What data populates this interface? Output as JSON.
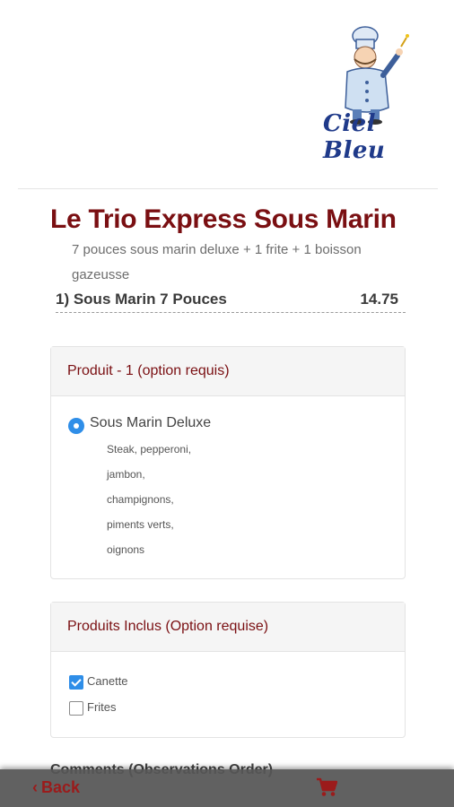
{
  "header": {
    "logo_text": "Ciel Bleu"
  },
  "product": {
    "title": "Le Trio Express Sous Marin",
    "description": "7 pouces sous marin deluxe + 1 frite + 1 boisson gazeusse",
    "item_name": "1) Sous Marin 7 Pouces",
    "item_price": "14.75"
  },
  "options_panel": {
    "heading": "Produit - 1 (option requis)",
    "selected_option": "Sous Marin Deluxe",
    "ingredients": [
      "Steak, pepperoni,",
      "jambon,",
      "champignons,",
      "piments verts,",
      "oignons"
    ]
  },
  "included_panel": {
    "heading": "Produits Inclus (Option requise)",
    "items": [
      {
        "label": "Canette",
        "checked": true
      },
      {
        "label": "Frites",
        "checked": false
      }
    ]
  },
  "comments": {
    "label": "Comments (Observations Order)"
  },
  "footer": {
    "back_label": "Back",
    "back_icon": "chevron-left-icon",
    "cart_icon": "cart-icon"
  },
  "colors": {
    "accent": "#7a0f12",
    "checkbox": "#2f8ee8",
    "bar": "#555555"
  }
}
